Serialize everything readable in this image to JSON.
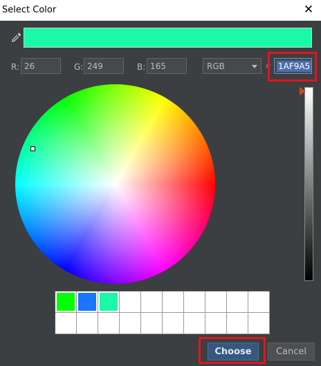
{
  "window": {
    "title": "Select Color",
    "close_symbol": "✕"
  },
  "color": {
    "preview_hex": "#1AF9A5",
    "r": "26",
    "g": "249",
    "b": "165",
    "hex": "1AF9A5"
  },
  "labels": {
    "r": "R:",
    "g": "G:",
    "b": "B:",
    "hash": "#"
  },
  "mode": {
    "selected": "RGB"
  },
  "brightness_level": 1.0,
  "recent_colors": [
    "#00ff00",
    "#1a75ff",
    "#1af9a5",
    "#ffffff",
    "#ffffff",
    "#ffffff",
    "#ffffff",
    "#ffffff",
    "#ffffff",
    "#ffffff",
    "#ffffff",
    "#ffffff",
    "#ffffff",
    "#ffffff",
    "#ffffff",
    "#ffffff",
    "#ffffff",
    "#ffffff",
    "#ffffff",
    "#ffffff"
  ],
  "buttons": {
    "choose": "Choose",
    "cancel": "Cancel"
  },
  "highlight_color": "#e0151d",
  "icons": {
    "dropper": "eyedropper-icon",
    "mode_arrow": "dropdown-arrow-icon",
    "close": "close-icon"
  }
}
